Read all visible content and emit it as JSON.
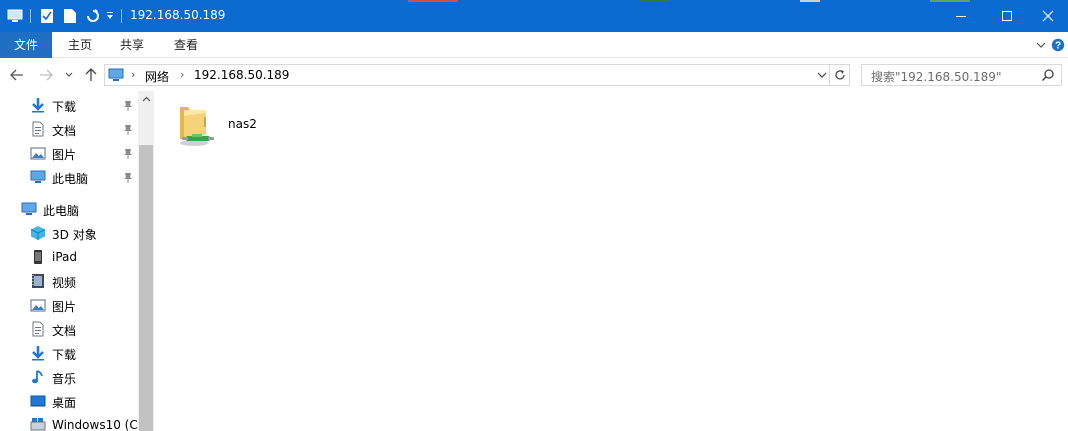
{
  "window": {
    "title": "192.168.50.189",
    "accent": "#0a6ad0"
  },
  "ribbon": {
    "tabs": [
      "文件",
      "主页",
      "共享",
      "查看"
    ]
  },
  "address": {
    "crumbs": [
      "网络",
      "192.168.50.189"
    ]
  },
  "search": {
    "placeholder": "搜索\"192.168.50.189\""
  },
  "sidebar": {
    "quick_access": [
      {
        "label": "下载",
        "icon": "download-icon"
      },
      {
        "label": "文档",
        "icon": "document-icon"
      },
      {
        "label": "图片",
        "icon": "picture-icon"
      },
      {
        "label": "此电脑",
        "icon": "computer-icon"
      }
    ],
    "this_pc": {
      "label": "此电脑",
      "icon": "computer-icon"
    },
    "children": [
      {
        "label": "3D 对象",
        "icon": "cube-icon"
      },
      {
        "label": "iPad",
        "icon": "phone-icon"
      },
      {
        "label": "视频",
        "icon": "video-icon"
      },
      {
        "label": "图片",
        "icon": "picture-icon"
      },
      {
        "label": "文档",
        "icon": "document-icon"
      },
      {
        "label": "下载",
        "icon": "download-icon"
      },
      {
        "label": "音乐",
        "icon": "music-icon"
      },
      {
        "label": "桌面",
        "icon": "desktop-icon"
      },
      {
        "label": "Windows10 (C:",
        "icon": "drive-icon"
      }
    ]
  },
  "content": {
    "items": [
      {
        "label": "nas2",
        "icon": "network-share-folder-icon"
      }
    ]
  }
}
